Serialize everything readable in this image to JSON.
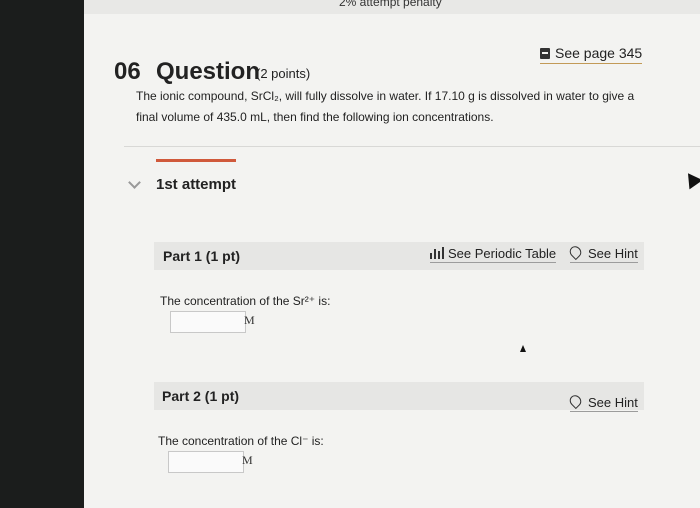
{
  "header": {
    "penalty_text": "2% attempt penalty"
  },
  "question": {
    "number": "06",
    "title": "Question",
    "points": "(2 points)",
    "see_page": "See page 345",
    "text_line1": "The ionic compound, SrCl₂, will fully dissolve in water. If 17.10 g is dissolved in water to give a",
    "text_line2": "final volume of 435.0 mL, then find the following ion concentrations."
  },
  "attempt": {
    "label": "1st attempt"
  },
  "parts": [
    {
      "label": "Part 1 (1 pt)",
      "periodic_table_link": "See Periodic Table",
      "hint_link": "See Hint",
      "prompt": "The concentration of the Sr²⁺ is:",
      "answer_value": "",
      "unit": "M"
    },
    {
      "label": "Part 2 (1 pt)",
      "hint_link": "See Hint",
      "prompt": "The concentration of the Cl⁻ is:",
      "answer_value": "",
      "unit": "M"
    }
  ],
  "colors": {
    "accent": "#d0593b",
    "page_bg": "#f3f3f1",
    "part_bar": "#e6e6e4"
  },
  "icons": [
    "book-icon",
    "chevron-down-icon",
    "bar-chart-icon",
    "lightbulb-icon"
  ]
}
